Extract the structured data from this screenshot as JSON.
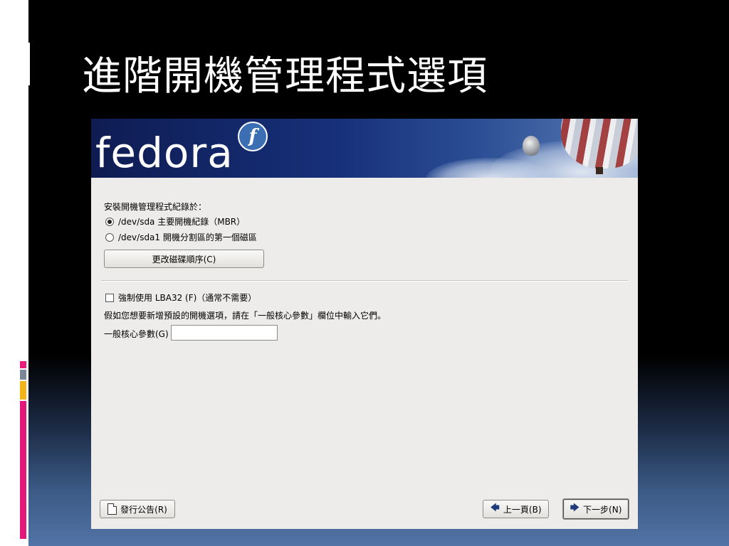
{
  "slide": {
    "title": "進階開機管理程式選項"
  },
  "installer": {
    "banner": {
      "logo_text": "fedora",
      "logo_badge": "f"
    },
    "bootloader_location_label": "安裝開機管理程式紀錄於：",
    "options": [
      {
        "label": "/dev/sda 主要開機紀錄（MBR）",
        "selected": true
      },
      {
        "label": "/dev/sda1 開機分割區的第一個磁區",
        "selected": false
      }
    ],
    "change_drive_order_button": "更改磁碟順序(C)",
    "force_lba32": {
      "label": "強制使用 LBA32 (F)（通常不需要）",
      "checked": false
    },
    "kernel_params_hint": "假如您想要新增預設的開機選項，請在「一般核心參數」欄位中輸入它們。",
    "kernel_params_label": "一般核心參數(G)",
    "kernel_params_value": "",
    "release_notes_button": "發行公告(R)",
    "back_button": "上一頁(B)",
    "next_button": "下一步(N)"
  },
  "colors": {
    "installer_bg": "#edeceb",
    "banner_blue": "#17307a",
    "accent_pink": "#e91e7a",
    "accent_yellow": "#f2b418"
  },
  "icons": {
    "release_notes": "document-icon",
    "back": "left-arrow-icon",
    "next": "right-arrow-icon"
  }
}
